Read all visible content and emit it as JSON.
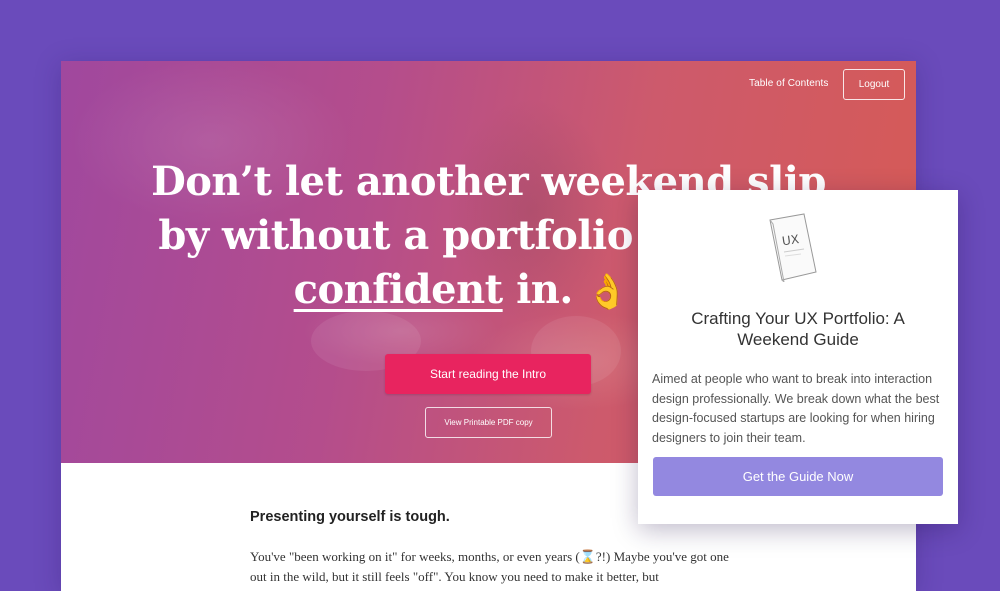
{
  "nav": {
    "toc_label": "Table of Contents",
    "logout_label": "Logout"
  },
  "hero": {
    "headline_line1": "Don’t let another weekend slip",
    "headline_line2": "by without a portfolio you feel",
    "headline_word_underlined": "confident",
    "headline_word_in": "in.",
    "emoji_ok": "👌",
    "emoji_thumbs": "👍",
    "primary_button": "Start reading the Intro",
    "secondary_button": "View Printable PDF copy"
  },
  "content": {
    "heading": "Presenting yourself is tough.",
    "paragraph": "You've \"been working on it\" for weeks, months, or even years (⌛?!) Maybe you've got one out in the wild, but it still feels \"off\". You know you need to make it better, but"
  },
  "guide_card": {
    "book_label": "UX",
    "title": "Crafting Your UX Portfolio: A Weekend Guide",
    "description": "Aimed at people who want to break into interaction design professionally. We break down what the best design-focused startups are looking for when hiring designers to join their team.",
    "button": "Get the Guide Now"
  },
  "colors": {
    "page_background": "#6a4bbb",
    "primary_button": "#e8245f",
    "guide_button": "#9388e0"
  }
}
